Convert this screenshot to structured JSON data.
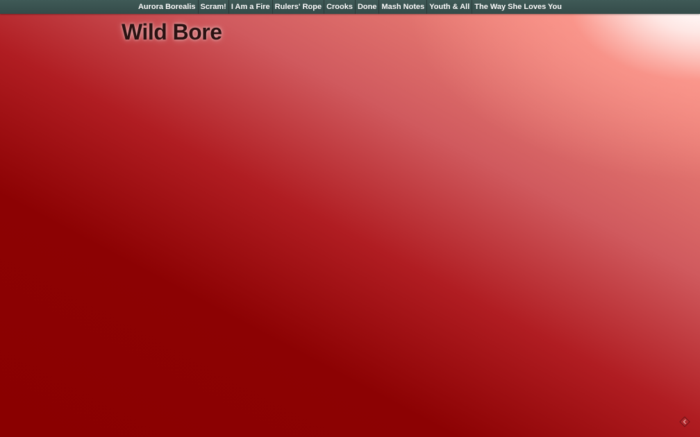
{
  "nav": {
    "items": [
      {
        "label": "Aurora Borealis"
      },
      {
        "label": "Scram!"
      },
      {
        "label": "I Am a Fire"
      },
      {
        "label": "Rulers' Rope"
      },
      {
        "label": "Crooks"
      },
      {
        "label": "Done"
      },
      {
        "label": "Mash Notes"
      },
      {
        "label": "Youth & All"
      },
      {
        "label": "The Way She Loves You"
      }
    ]
  },
  "page": {
    "title": "Wild Bore"
  },
  "corner": {
    "icon": "diamond-arrow-icon"
  },
  "colors": {
    "topbar": "#3f5a57",
    "background_dark": "#8a0000",
    "background_light": "#ffffff",
    "title": "#2a1212"
  }
}
